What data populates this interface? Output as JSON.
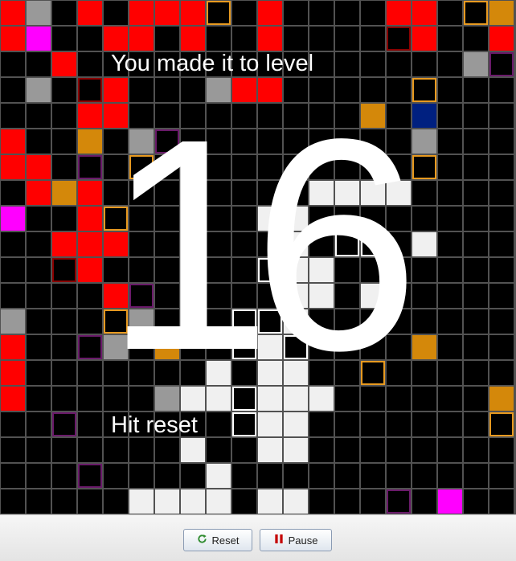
{
  "game": {
    "message_line1": "You made it to level",
    "message_line2": "Hit reset",
    "level": "16",
    "grid": {
      "columns": 20,
      "rows": 20
    },
    "colors": {
      "empty": "#000000",
      "red": "#ff0000",
      "gray": "#999999",
      "orange": "#d4880a",
      "magenta": "#ff00ff",
      "blue": "#002080",
      "white": "#f0f0f0"
    },
    "cells": [
      [
        0,
        0,
        "red"
      ],
      [
        1,
        0,
        "gray"
      ],
      [
        3,
        0,
        "red"
      ],
      [
        5,
        0,
        "red"
      ],
      [
        6,
        0,
        "red"
      ],
      [
        7,
        0,
        "red"
      ],
      [
        8,
        0,
        "o-orange"
      ],
      [
        10,
        0,
        "red"
      ],
      [
        15,
        0,
        "red"
      ],
      [
        16,
        0,
        "red"
      ],
      [
        18,
        0,
        "o-orange"
      ],
      [
        19,
        0,
        "orange"
      ],
      [
        0,
        1,
        "red"
      ],
      [
        1,
        1,
        "magenta"
      ],
      [
        4,
        1,
        "red"
      ],
      [
        5,
        1,
        "red"
      ],
      [
        7,
        1,
        "red"
      ],
      [
        10,
        1,
        "red"
      ],
      [
        15,
        1,
        "o-darkred"
      ],
      [
        16,
        1,
        "red"
      ],
      [
        19,
        1,
        "red"
      ],
      [
        2,
        2,
        "red"
      ],
      [
        18,
        2,
        "gray"
      ],
      [
        19,
        2,
        "o-purple"
      ],
      [
        1,
        3,
        "gray"
      ],
      [
        3,
        3,
        "o-darkred"
      ],
      [
        4,
        3,
        "red"
      ],
      [
        8,
        3,
        "gray"
      ],
      [
        9,
        3,
        "red"
      ],
      [
        10,
        3,
        "red"
      ],
      [
        16,
        3,
        "o-orange"
      ],
      [
        3,
        4,
        "red"
      ],
      [
        4,
        4,
        "red"
      ],
      [
        14,
        4,
        "orange"
      ],
      [
        16,
        4,
        "blue"
      ],
      [
        0,
        5,
        "red"
      ],
      [
        3,
        5,
        "orange"
      ],
      [
        5,
        5,
        "gray"
      ],
      [
        6,
        5,
        "o-purple"
      ],
      [
        16,
        5,
        "gray"
      ],
      [
        0,
        6,
        "red"
      ],
      [
        1,
        6,
        "red"
      ],
      [
        3,
        6,
        "o-purple"
      ],
      [
        5,
        6,
        "o-orange"
      ],
      [
        16,
        6,
        "o-orange"
      ],
      [
        1,
        7,
        "red"
      ],
      [
        2,
        7,
        "orange"
      ],
      [
        3,
        7,
        "red"
      ],
      [
        12,
        7,
        "white"
      ],
      [
        13,
        7,
        "white"
      ],
      [
        14,
        7,
        "white"
      ],
      [
        15,
        7,
        "white"
      ],
      [
        0,
        8,
        "magenta"
      ],
      [
        3,
        8,
        "red"
      ],
      [
        4,
        8,
        "o-orange"
      ],
      [
        10,
        8,
        "white"
      ],
      [
        11,
        8,
        "white"
      ],
      [
        2,
        9,
        "red"
      ],
      [
        3,
        9,
        "red"
      ],
      [
        4,
        9,
        "red"
      ],
      [
        11,
        9,
        "white"
      ],
      [
        13,
        9,
        "o-white"
      ],
      [
        14,
        9,
        "o-white"
      ],
      [
        16,
        9,
        "white"
      ],
      [
        2,
        10,
        "o-darkred"
      ],
      [
        3,
        10,
        "red"
      ],
      [
        10,
        10,
        "o-white"
      ],
      [
        11,
        10,
        "white"
      ],
      [
        12,
        10,
        "white"
      ],
      [
        4,
        11,
        "red"
      ],
      [
        5,
        11,
        "o-purple"
      ],
      [
        7,
        11,
        "white"
      ],
      [
        11,
        11,
        "white"
      ],
      [
        12,
        11,
        "white"
      ],
      [
        14,
        11,
        "white"
      ],
      [
        0,
        12,
        "gray"
      ],
      [
        4,
        12,
        "o-orange"
      ],
      [
        5,
        12,
        "gray"
      ],
      [
        9,
        12,
        "o-white"
      ],
      [
        10,
        12,
        "o-white"
      ],
      [
        11,
        12,
        "white"
      ],
      [
        0,
        13,
        "red"
      ],
      [
        3,
        13,
        "o-purple"
      ],
      [
        4,
        13,
        "gray"
      ],
      [
        6,
        13,
        "orange"
      ],
      [
        9,
        13,
        "o-white"
      ],
      [
        10,
        13,
        "white"
      ],
      [
        11,
        13,
        "o-white"
      ],
      [
        16,
        13,
        "orange"
      ],
      [
        0,
        14,
        "red"
      ],
      [
        8,
        14,
        "white"
      ],
      [
        10,
        14,
        "white"
      ],
      [
        11,
        14,
        "white"
      ],
      [
        14,
        14,
        "o-orange"
      ],
      [
        0,
        15,
        "red"
      ],
      [
        6,
        15,
        "gray"
      ],
      [
        7,
        15,
        "white"
      ],
      [
        8,
        15,
        "white"
      ],
      [
        9,
        15,
        "o-white"
      ],
      [
        10,
        15,
        "white"
      ],
      [
        11,
        15,
        "white"
      ],
      [
        12,
        15,
        "white"
      ],
      [
        19,
        15,
        "orange"
      ],
      [
        2,
        16,
        "o-purple"
      ],
      [
        9,
        16,
        "o-white"
      ],
      [
        10,
        16,
        "white"
      ],
      [
        11,
        16,
        "white"
      ],
      [
        19,
        16,
        "o-orange"
      ],
      [
        7,
        17,
        "white"
      ],
      [
        10,
        17,
        "white"
      ],
      [
        11,
        17,
        "white"
      ],
      [
        3,
        18,
        "o-purple"
      ],
      [
        8,
        18,
        "white"
      ],
      [
        5,
        19,
        "white"
      ],
      [
        6,
        19,
        "white"
      ],
      [
        7,
        19,
        "white"
      ],
      [
        8,
        19,
        "white"
      ],
      [
        10,
        19,
        "white"
      ],
      [
        11,
        19,
        "white"
      ],
      [
        15,
        19,
        "o-purple"
      ],
      [
        17,
        19,
        "magenta"
      ]
    ]
  },
  "toolbar": {
    "reset_label": "Reset",
    "pause_label": "Pause",
    "reset_icon": "refresh-icon",
    "pause_icon": "pause-icon"
  }
}
